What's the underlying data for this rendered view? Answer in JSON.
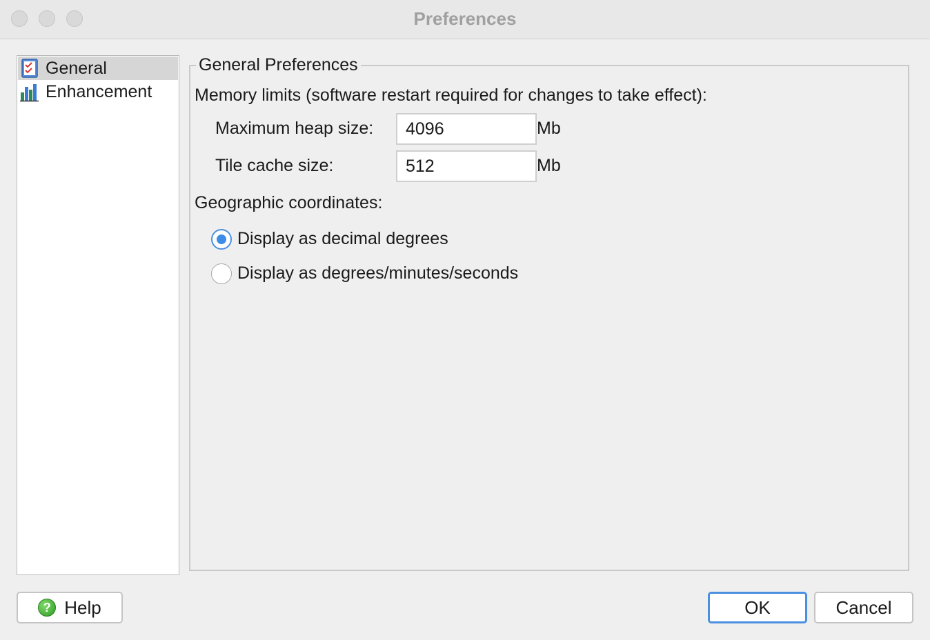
{
  "window": {
    "title": "Preferences"
  },
  "sidebar": {
    "items": [
      {
        "label": "General",
        "icon": "checklist-icon",
        "selected": true
      },
      {
        "label": "Enhancement",
        "icon": "bar-chart-icon",
        "selected": false
      }
    ]
  },
  "panel": {
    "group_title": "General Preferences",
    "memory_label": "Memory limits (software restart required for changes to take effect):",
    "heap_label": "Maximum heap size:",
    "heap_value": "4096",
    "heap_unit": "Mb",
    "tile_label": "Tile cache size:",
    "tile_value": "512",
    "tile_unit": "Mb",
    "coords_label": "Geographic coordinates:",
    "options": [
      {
        "label": "Display as decimal degrees",
        "checked": true
      },
      {
        "label": "Display as degrees/minutes/seconds",
        "checked": false
      }
    ]
  },
  "buttons": {
    "help": "Help",
    "ok": "OK",
    "cancel": "Cancel"
  },
  "colors": {
    "accent": "#3b8de6",
    "selection": "#d6d6d6"
  }
}
